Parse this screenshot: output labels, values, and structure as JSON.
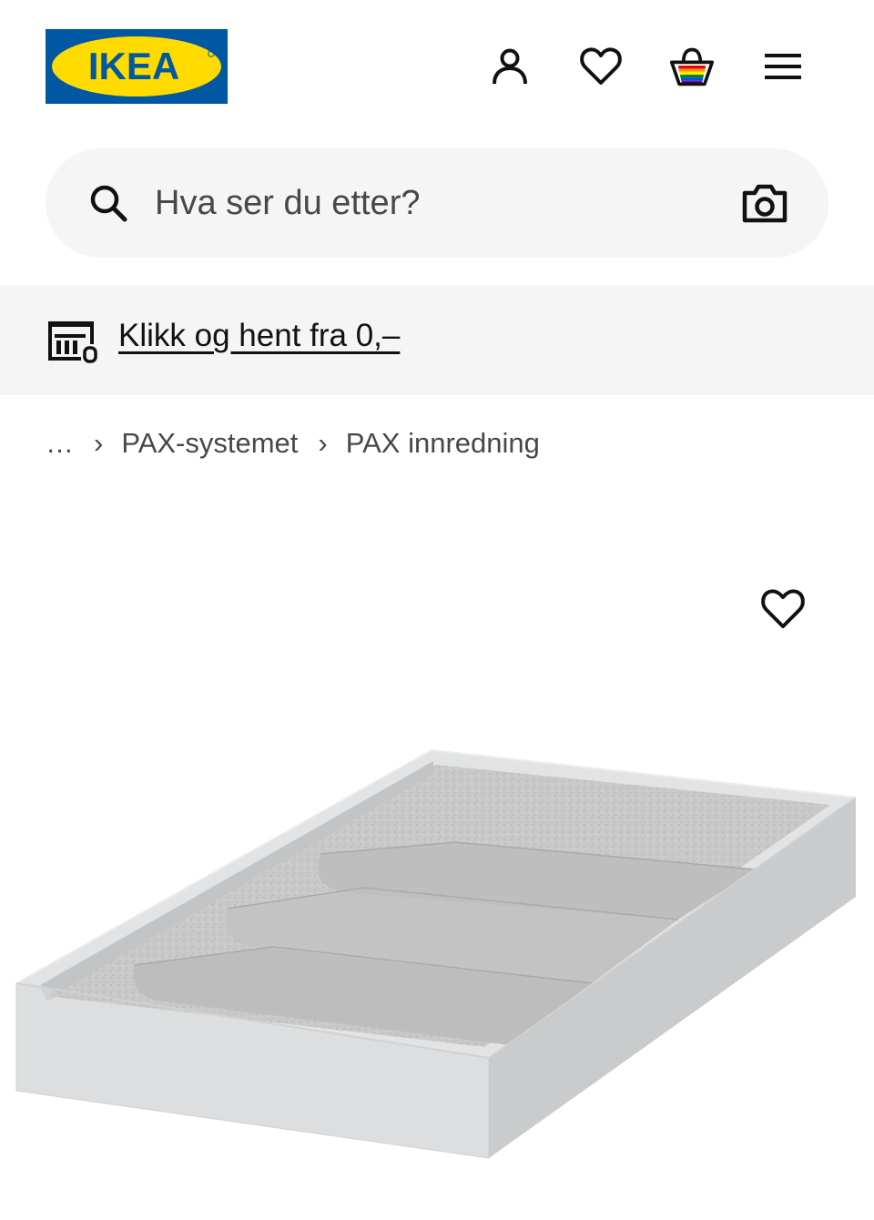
{
  "header": {
    "logo_text": "IKEA",
    "icons": {
      "account": "person-icon",
      "favorites": "heart-icon",
      "basket": "basket-icon",
      "menu": "hamburger-menu-icon"
    }
  },
  "search": {
    "placeholder": "Hva ser du etter?",
    "value": "",
    "icon": "search-icon",
    "visual_search_icon": "camera-icon"
  },
  "promo": {
    "icon": "store-icon",
    "label": "Klikk og hent fra 0,–"
  },
  "breadcrumb": {
    "items": [
      "…",
      "PAX-systemet",
      "PAX innredning"
    ],
    "separator": "›"
  },
  "product": {
    "favorite_icon": "heart-icon",
    "image_icon": "drawer-insert-tray-image"
  },
  "colors": {
    "brand_blue": "#0058a3",
    "brand_yellow": "#ffdb00",
    "search_bg": "#f5f5f5",
    "text_primary": "#111111",
    "text_secondary": "#484848"
  }
}
